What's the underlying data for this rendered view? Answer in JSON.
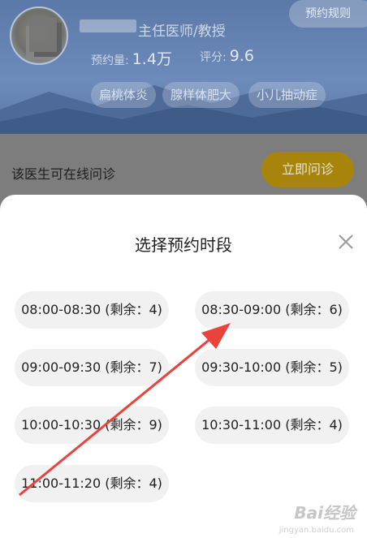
{
  "header": {
    "title": "主任医师/教授",
    "stats": [
      {
        "label": "预约量:",
        "value": "1.4万"
      },
      {
        "label": "评分:",
        "value": "9.6"
      }
    ],
    "rules_button": "预约规则",
    "tags": [
      "扁桃体炎",
      "腺样体肥大",
      "小儿抽动症"
    ]
  },
  "consult": {
    "label": "该医生可在线问诊",
    "button": "立即问诊"
  },
  "sheet": {
    "title": "选择预约时段",
    "slots": [
      "08:00-08:30 (剩余：4)",
      "08:30-09:00 (剩余：6)",
      "09:00-09:30 (剩余：7)",
      "09:30-10:00 (剩余：5)",
      "10:00-10:30 (剩余：9)",
      "10:30-11:00 (剩余：4)",
      "11:00-11:20 (剩余：4)"
    ]
  },
  "watermark": {
    "text": "Bai经验",
    "sub": "jingyan.baidu.com"
  },
  "colors": {
    "arrow": "#e8433c",
    "accent": "#f2c012"
  }
}
